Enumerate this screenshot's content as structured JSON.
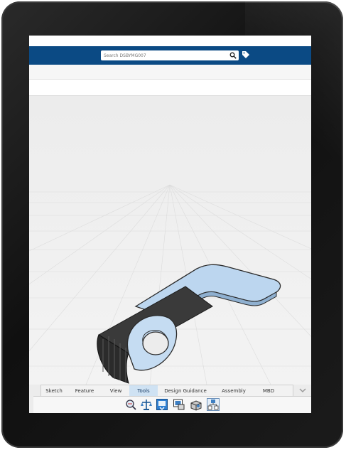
{
  "search": {
    "placeholder": "Search DSBYMG007"
  },
  "icons": {
    "search": "search-icon",
    "tag": "tag-icon",
    "collapse": "chevron-down-icon",
    "tools": [
      "measure-icon",
      "mass-properties-icon",
      "compare-icon",
      "sensor-icon",
      "interference-icon",
      "assembly-structure-icon"
    ]
  },
  "command_manager": {
    "tabs": [
      {
        "label": "Sketch"
      },
      {
        "label": "Feature"
      },
      {
        "label": "View"
      },
      {
        "label": "Tools"
      },
      {
        "label": "Design Guidance"
      },
      {
        "label": "Assembly"
      },
      {
        "label": "MBD"
      }
    ],
    "active_tab": "Tools"
  },
  "colors": {
    "header": "#0b4a84",
    "active_tab": "#cfe2f3",
    "part_blue": "#b9d4ef",
    "rubber_dark": "#2b2b2b"
  }
}
